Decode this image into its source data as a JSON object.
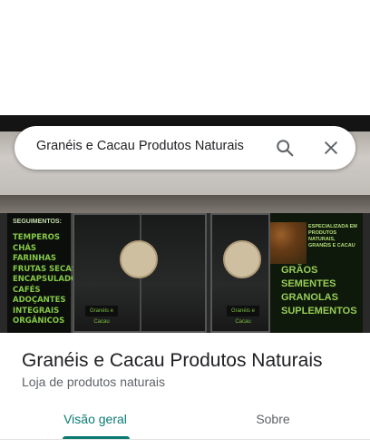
{
  "search": {
    "query": "Granéis e Cacau Produtos Naturais"
  },
  "place": {
    "name": "Granéis e Cacau Produtos Naturais",
    "category": "Loja de produtos naturais"
  },
  "tabs": [
    {
      "label": "Visão geral",
      "active": true
    },
    {
      "label": "Sobre",
      "active": false
    }
  ],
  "photo": {
    "panel_left_title": "SEGUIMENTOS:",
    "panel_left_items": [
      "TEMPEROS",
      "CHÁS",
      "FARINHAS",
      "FRUTAS SECAS",
      "ENCAPSULADOS",
      "CAFÉS",
      "ADOÇANTES",
      "INTEGRAIS",
      "ORGÂNICOS"
    ],
    "panel_right_promo": "ESPECIALIZADA EM PRODUTOS NATURAIS, GRANÉIS E CACAU",
    "panel_right_lines": [
      "GRÃOS",
      "SEMENTES",
      "GRANOLAS",
      "SUPLEMENTOS"
    ],
    "door_logo_text": "Granéis e Cacau"
  },
  "colors": {
    "accent": "#0b7a72",
    "text_primary": "#202124",
    "text_secondary": "#5f6368"
  },
  "icons": {
    "search": "search-icon",
    "close": "close-icon"
  }
}
